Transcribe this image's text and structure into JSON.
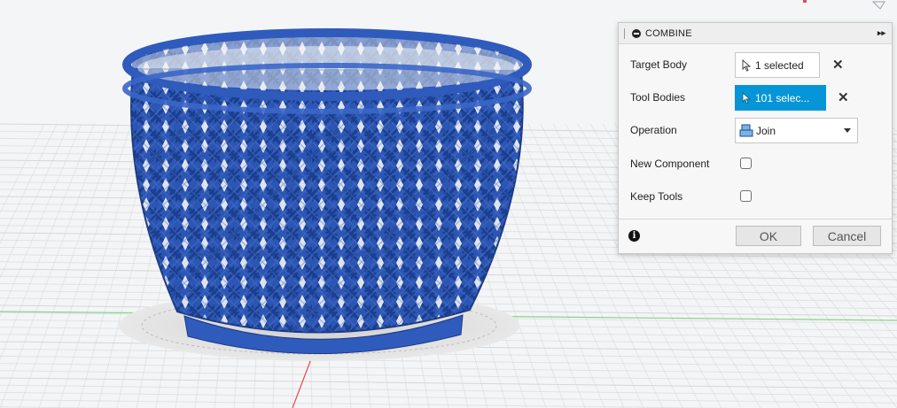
{
  "panel": {
    "title": "COMBINE",
    "rows": {
      "target_body": {
        "label": "Target Body",
        "value": "1 selected"
      },
      "tool_bodies": {
        "label": "Tool Bodies",
        "value": "101 selec..."
      },
      "operation": {
        "label": "Operation",
        "value": "Join"
      },
      "new_component": {
        "label": "New Component",
        "checked": false
      },
      "keep_tools": {
        "label": "Keep Tools",
        "checked": false
      }
    },
    "buttons": {
      "ok": "OK",
      "cancel": "Cancel"
    },
    "info_glyph": "i"
  },
  "colors": {
    "accent": "#0696d7",
    "model": "#2c56b5",
    "grid": "#d0d3d6",
    "x_axis": "#e04c4c",
    "y_axis": "#5fc45f"
  },
  "icons": [
    "minus-circle-icon",
    "fast-forward-icon",
    "cursor-icon",
    "close-icon",
    "join-icon",
    "chevron-down-icon",
    "info-icon",
    "viewcube-icon"
  ]
}
